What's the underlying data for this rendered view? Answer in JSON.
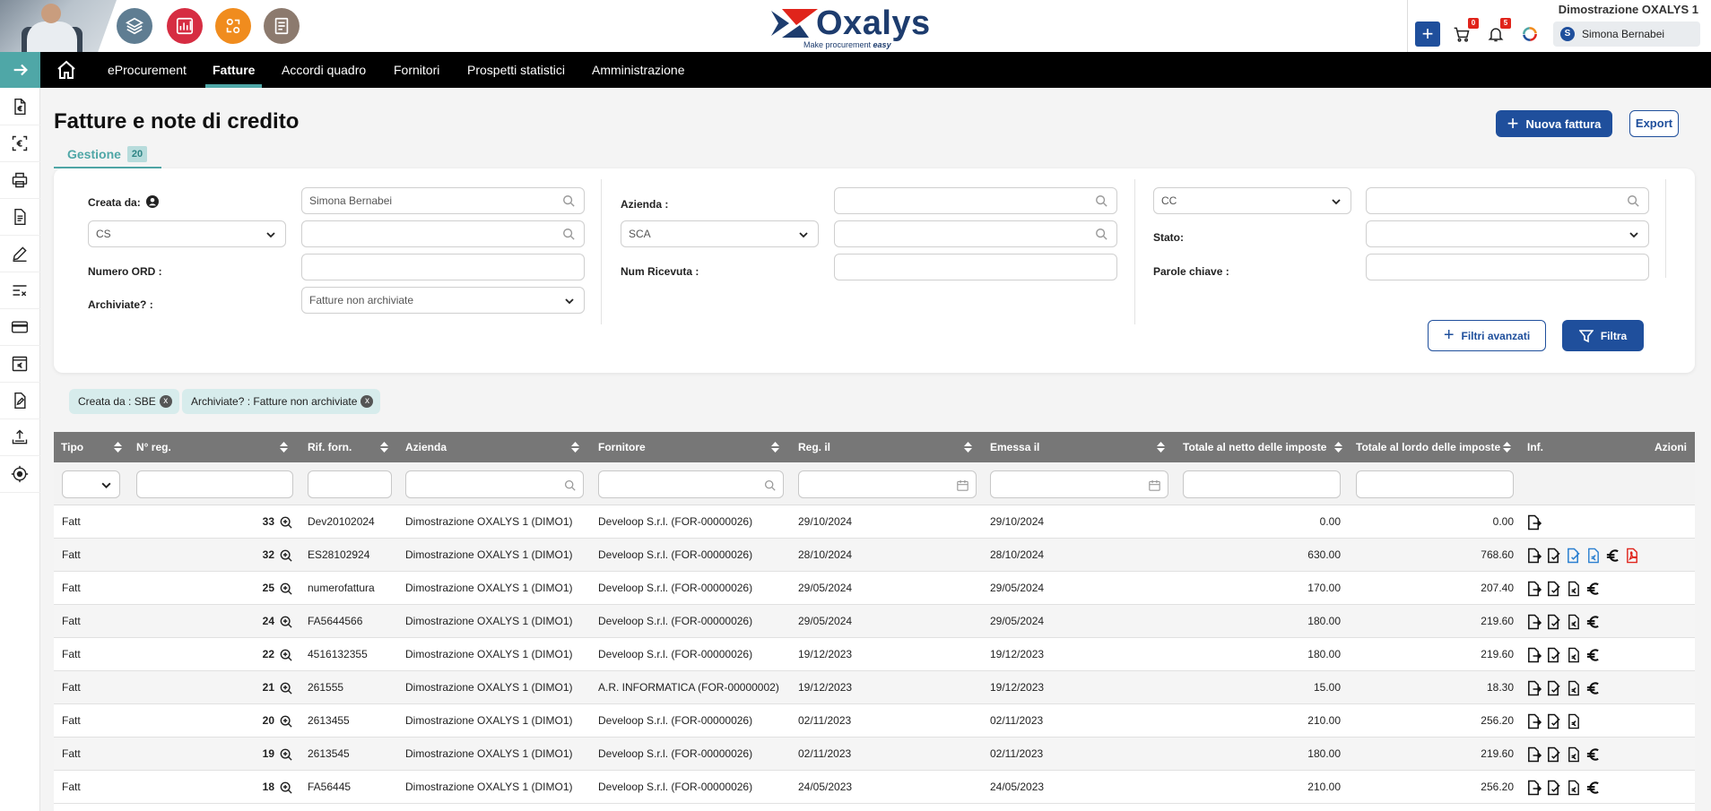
{
  "header": {
    "tenant": "Dimostrazione OXALYS 1",
    "logo_word": "Oxalys",
    "logo_tagline_prefix": "Make procurement ",
    "logo_tagline_em": "easy",
    "new_button_label": "+",
    "cart_count": "0",
    "notifications_count": "5",
    "user_initial": "S",
    "user_name": "Simona Bernabei"
  },
  "nav": {
    "items": [
      {
        "label": "eProcurement"
      },
      {
        "label": "Fatture"
      },
      {
        "label": "Accordi quadro"
      },
      {
        "label": "Fornitori"
      },
      {
        "label": "Prospetti statistici"
      },
      {
        "label": "Amministrazione"
      }
    ],
    "active": "Fatture"
  },
  "page": {
    "title": "Fatture e note di credito",
    "tab_label": "Gestione",
    "tab_count": "20",
    "new_invoice_label": "Nuova fattura",
    "export_label": "Export"
  },
  "filters": {
    "created_by_label": "Creata da:",
    "created_by_value": "Simona Bernabei",
    "cs_select": "CS",
    "order_number_label": "Numero ORD :",
    "archived_label": "Archiviate? :",
    "archived_value": "Fatture non archiviate",
    "company_label": "Azienda :",
    "sca_select": "SCA",
    "receipt_number_label": "Num Ricevuta :",
    "cc_select": "CC",
    "status_label": "Stato:",
    "keywords_label": "Parole chiave :",
    "advanced_label": "Filtri avanzati",
    "apply_label": "Filtra"
  },
  "chips": [
    {
      "label": "Creata da : SBE"
    },
    {
      "label": "Archiviate? : Fatture non archiviate"
    }
  ],
  "table": {
    "columns": [
      "Tipo",
      "N° reg.",
      "Rif. forn.",
      "Azienda",
      "Fornitore",
      "Reg. il",
      "Emessa il",
      "Totale al netto delle imposte",
      "Totale al lordo delle imposte",
      "Inf.",
      "Azioni"
    ],
    "rows": [
      {
        "tipo": "Fatt",
        "nreg": "33",
        "rif": "Dev20102024",
        "azienda": "Dimostrazione OXALYS 1 (DIMO1)",
        "fornitore": "Develoop S.r.l. (FOR-00000026)",
        "reg": "29/10/2024",
        "emessa": "29/10/2024",
        "netto": "0.00",
        "lordo": "0.00",
        "icons": [
          "doc-arrow"
        ]
      },
      {
        "tipo": "Fatt",
        "nreg": "32",
        "rif": "ES28102924",
        "azienda": "Dimostrazione OXALYS 1 (DIMO1)",
        "fornitore": "Develoop S.r.l. (FOR-00000026)",
        "reg": "28/10/2024",
        "emessa": "28/10/2024",
        "netto": "630.00",
        "lordo": "768.60",
        "icons": [
          "doc-arrow",
          "doc-check",
          "doc-check-blue",
          "doc-euro-blue",
          "euro",
          "pdf"
        ]
      },
      {
        "tipo": "Fatt",
        "nreg": "25",
        "rif": "numerofattura",
        "azienda": "Dimostrazione OXALYS 1 (DIMO1)",
        "fornitore": "Develoop S.r.l. (FOR-00000026)",
        "reg": "29/05/2024",
        "emessa": "29/05/2024",
        "netto": "170.00",
        "lordo": "207.40",
        "icons": [
          "doc-arrow",
          "doc-check",
          "doc-euro",
          "euro"
        ]
      },
      {
        "tipo": "Fatt",
        "nreg": "24",
        "rif": "FA5644566",
        "azienda": "Dimostrazione OXALYS 1 (DIMO1)",
        "fornitore": "Develoop S.r.l. (FOR-00000026)",
        "reg": "29/05/2024",
        "emessa": "29/05/2024",
        "netto": "180.00",
        "lordo": "219.60",
        "icons": [
          "doc-arrow",
          "doc-check",
          "doc-euro",
          "euro"
        ]
      },
      {
        "tipo": "Fatt",
        "nreg": "22",
        "rif": "4516132355",
        "azienda": "Dimostrazione OXALYS 1 (DIMO1)",
        "fornitore": "Develoop S.r.l. (FOR-00000026)",
        "reg": "19/12/2023",
        "emessa": "19/12/2023",
        "netto": "180.00",
        "lordo": "219.60",
        "icons": [
          "doc-arrow",
          "doc-check",
          "doc-euro",
          "euro"
        ]
      },
      {
        "tipo": "Fatt",
        "nreg": "21",
        "rif": "261555",
        "azienda": "Dimostrazione OXALYS 1 (DIMO1)",
        "fornitore": "A.R. INFORMATICA (FOR-00000002)",
        "reg": "19/12/2023",
        "emessa": "19/12/2023",
        "netto": "15.00",
        "lordo": "18.30",
        "icons": [
          "doc-arrow",
          "doc-check",
          "doc-euro",
          "euro"
        ]
      },
      {
        "tipo": "Fatt",
        "nreg": "20",
        "rif": "2613455",
        "azienda": "Dimostrazione OXALYS 1 (DIMO1)",
        "fornitore": "Develoop S.r.l. (FOR-00000026)",
        "reg": "02/11/2023",
        "emessa": "02/11/2023",
        "netto": "210.00",
        "lordo": "256.20",
        "icons": [
          "doc-arrow",
          "doc-check",
          "doc-euro"
        ]
      },
      {
        "tipo": "Fatt",
        "nreg": "19",
        "rif": "2613545",
        "azienda": "Dimostrazione OXALYS 1 (DIMO1)",
        "fornitore": "Develoop S.r.l. (FOR-00000026)",
        "reg": "02/11/2023",
        "emessa": "02/11/2023",
        "netto": "180.00",
        "lordo": "219.60",
        "icons": [
          "doc-arrow",
          "doc-check",
          "doc-euro",
          "euro"
        ]
      },
      {
        "tipo": "Fatt",
        "nreg": "18",
        "rif": "FA56445",
        "azienda": "Dimostrazione OXALYS 1 (DIMO1)",
        "fornitore": "Develoop S.r.l. (FOR-00000026)",
        "reg": "24/05/2023",
        "emessa": "24/05/2023",
        "netto": "210.00",
        "lordo": "256.20",
        "icons": [
          "doc-arrow",
          "doc-check",
          "doc-euro",
          "euro"
        ]
      }
    ]
  },
  "colors": {
    "brand_blue": "#1f4f9c",
    "teal": "#4fa7a7",
    "header_grey": "#777777"
  }
}
